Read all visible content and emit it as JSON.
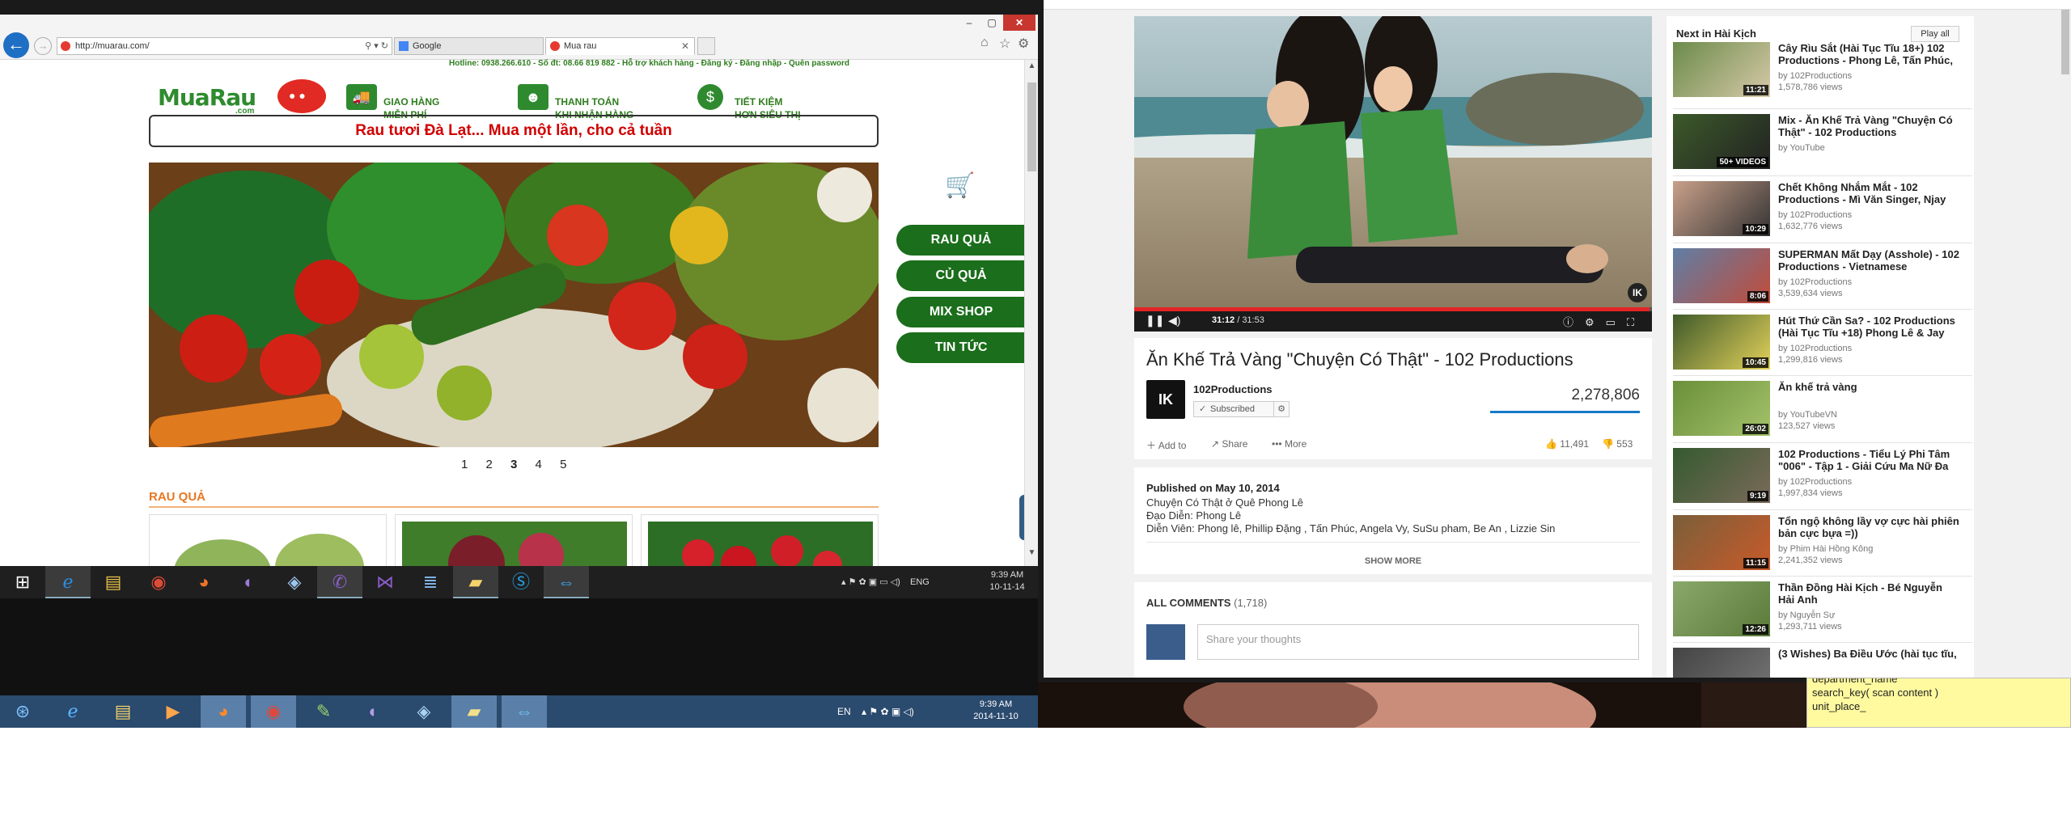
{
  "left_browser": {
    "address": "http://muarau.com/",
    "tabs": [
      {
        "label": "Google"
      },
      {
        "label": "Mua rau"
      }
    ],
    "window_controls": {
      "minimize": "–",
      "maximize": "▢",
      "close": "✕"
    },
    "toolbar_icons": [
      "home-icon",
      "star-icon",
      "gear-icon"
    ],
    "page": {
      "hotline": "Hotline: 0938.266.610  -  Số đt: 08.66 819 882  -  Hỗ trợ khách hàng  -  Đăng ký  -  Đăng nhập  -  Quên password",
      "logo": {
        "text": "MuaRau",
        "sub": ".com"
      },
      "features": [
        {
          "line1": "GIAO HÀNG",
          "line2": "MIỄN PHÍ",
          "icon": "truck-icon"
        },
        {
          "line1": "THANH TOÁN",
          "line2": "KHI NHẬN HÀNG",
          "icon": "person-icon"
        },
        {
          "line1": "TIẾT KIỆM",
          "line2": "HƠN SIÊU THỊ",
          "icon": "money-bag-icon"
        }
      ],
      "slogan": "Rau tươi Đà Lạt... Mua một lần, cho cả tuần",
      "categories": [
        "RAU QUẢ",
        "CỦ QUẢ",
        "MIX SHOP",
        "TIN TỨC"
      ],
      "pagination": [
        "1",
        "2",
        "3",
        "4",
        "5"
      ],
      "pagination_current": "3",
      "section_title": "RAU QUẢ"
    }
  },
  "taskbar_top": {
    "lang": "ENG",
    "time": "9:39 AM",
    "date": "10-11-14"
  },
  "taskbar_bottom": {
    "lang": "EN",
    "time": "9:39 AM",
    "date": "2014-11-10"
  },
  "youtube": {
    "player": {
      "time_current": "31:12",
      "time_total": "31:53",
      "progress": 0.995,
      "watermark": "IK"
    },
    "video": {
      "title": "Ăn Khế Trả Vàng \"Chuyện Có Thật\" - 102 Productions",
      "channel": "102Productions",
      "subscribe_label": "Subscribed",
      "views": "2,278,806",
      "actions": {
        "add": "Add to",
        "share": "Share",
        "more": "More"
      },
      "likes": "11,491",
      "dislikes": "553"
    },
    "description": {
      "published": "Published on May 10, 2014",
      "lines": [
        "Chuyện Có Thật ở Quê Phong Lê",
        "Đạo Diễn: Phong Lê",
        "Diễn Viên: Phong lê, Phillip Đặng , Tấn Phúc, Angela Vy, SuSu pham, Be An , Lizzie Sin"
      ],
      "show_more": "SHOW MORE"
    },
    "comments": {
      "title": "ALL COMMENTS",
      "count": "(1,718)",
      "placeholder": "Share your thoughts"
    },
    "up_next": {
      "title": "Next in Hài Kịch",
      "play_all": "Play all",
      "items": [
        {
          "title": "Cây Rìu Sắt (Hài Tục Tĩu 18+) 102 Productions - Phong Lê, Tấn Phúc,",
          "by": "by 102Productions",
          "views": "1,578,786 views",
          "duration": "11:21"
        },
        {
          "title": "Mix - Ăn Khế Trả Vàng \"Chuyện Có Thật\" - 102 Productions",
          "by": "by YouTube",
          "views": "",
          "duration": "50+ VIDEOS"
        },
        {
          "title": "Chết Không Nhắm Mắt - 102 Productions - Mì Văn Singer, Njay",
          "by": "by 102Productions",
          "views": "1,632,776 views",
          "duration": "10:29"
        },
        {
          "title": "SUPERMAN Mất Dạy (Asshole) - 102 Productions - Vietnamese",
          "by": "by 102Productions",
          "views": "3,539,634 views",
          "duration": "8:06"
        },
        {
          "title": "Hút Thứ Cần Sa? - 102 Productions (Hài Tục Tĩu +18) Phong Lê & Jay",
          "by": "by 102Productions",
          "views": "1,299,816 views",
          "duration": "10:45"
        },
        {
          "title": "Ăn khế trả vàng",
          "by": "by YouTubeVN",
          "views": "123,527 views",
          "duration": "26:02"
        },
        {
          "title": "102 Productions - Tiểu Lý Phi Tâm \"006\" - Tập 1 - Giải Cứu Ma Nữ Đa",
          "by": "by 102Productions",
          "views": "1,997,834 views",
          "duration": "9:19"
        },
        {
          "title": "Tổn ngộ không lầy vợ cực hài phiên bản cực bựa =))",
          "by": "by Phim Hài Hồng Kông",
          "views": "2,241,352 views",
          "duration": "11:15"
        },
        {
          "title": "Thần Đồng Hài Kịch - Bé Nguyễn Hải Anh",
          "by": "by Nguyễn Sự",
          "views": "1,293,711 views",
          "duration": "12:26"
        },
        {
          "title": "(3 Wishes) Ba Điều Ước (hài tục tĩu,",
          "by": "",
          "views": "",
          "duration": ""
        }
      ]
    }
  },
  "note": {
    "lines": [
      "department_name",
      "search_key( scan content )",
      "unit_place_"
    ]
  },
  "colors": {
    "muarau_green": "#1b6e1b",
    "slogan_red": "#d10000",
    "section_orange": "#e87722",
    "yt_red": "#e32525",
    "note_yellow": "#fffa9f"
  }
}
